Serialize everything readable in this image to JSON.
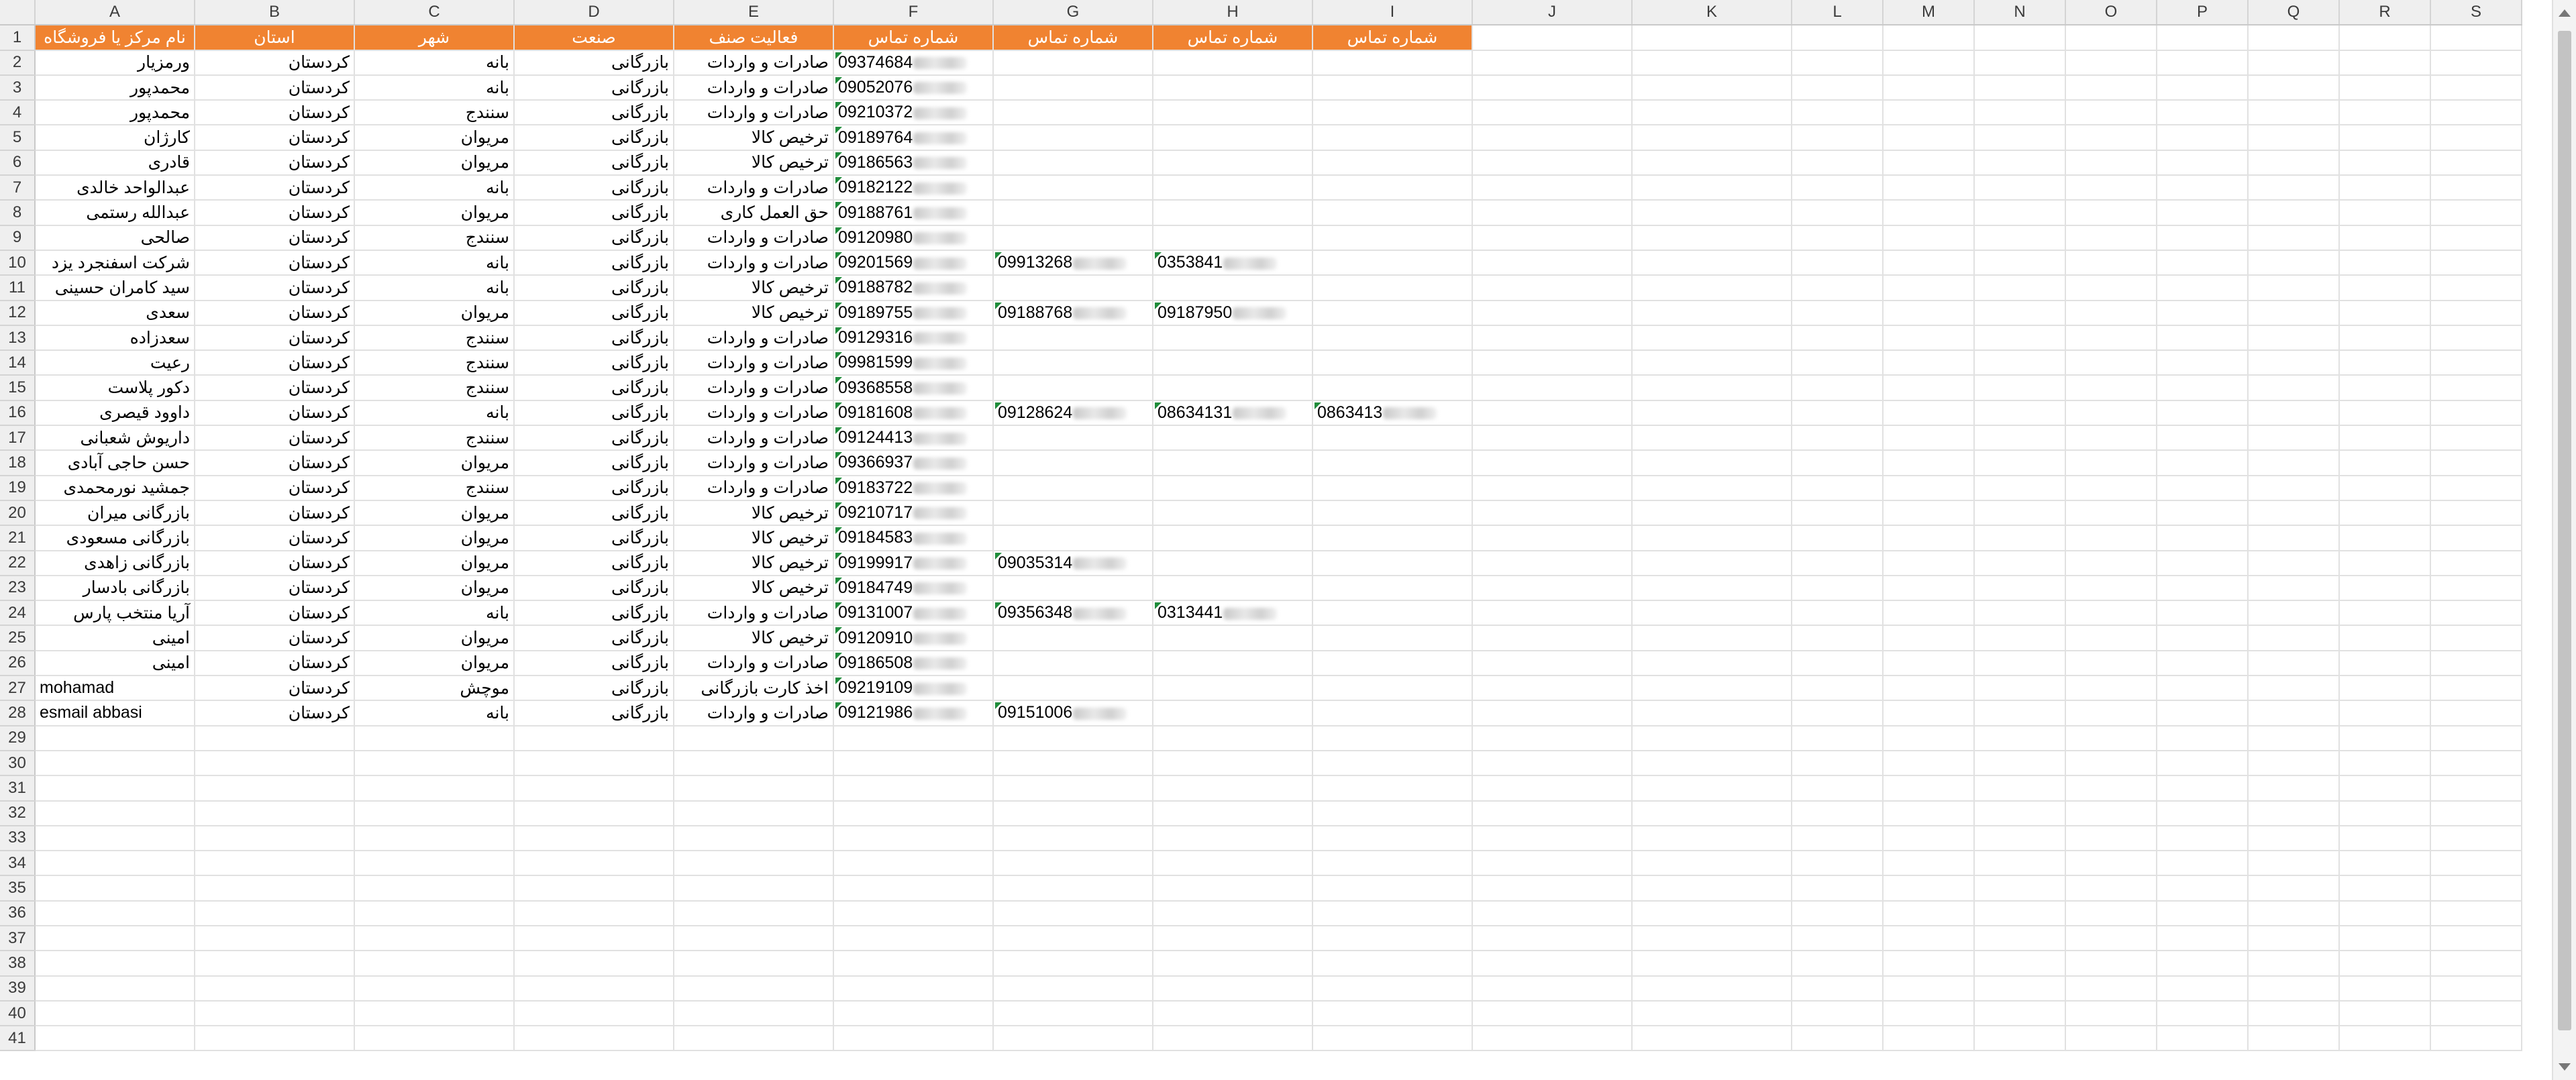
{
  "columns": [
    "A",
    "B",
    "C",
    "D",
    "E",
    "F",
    "G",
    "H",
    "I",
    "J",
    "K",
    "L",
    "M",
    "N",
    "O",
    "P",
    "Q",
    "R",
    "S"
  ],
  "header": [
    "نام مرکز یا فروشگاه",
    "استان",
    "شهر",
    "صنعت",
    "فعالیت صنف",
    "شماره تماس",
    "شماره تماس",
    "شماره تماس",
    "شماره تماس"
  ],
  "rows": [
    {
      "name": "ورمزیار",
      "province": "کردستان",
      "city": "بانه",
      "industry": "بازرگانی",
      "activity": "صادرات و واردات",
      "f": "09374684",
      "g": "",
      "h": "",
      "i": ""
    },
    {
      "name": "محمدپور",
      "province": "کردستان",
      "city": "بانه",
      "industry": "بازرگانی",
      "activity": "صادرات و واردات",
      "f": "09052076",
      "g": "",
      "h": "",
      "i": ""
    },
    {
      "name": "محمدپور",
      "province": "کردستان",
      "city": "سنندج",
      "industry": "بازرگانی",
      "activity": "صادرات و واردات",
      "f": "09210372",
      "g": "",
      "h": "",
      "i": ""
    },
    {
      "name": "کارژان",
      "province": "کردستان",
      "city": "مریوان",
      "industry": "بازرگانی",
      "activity": "ترخیص کالا",
      "f": "09189764",
      "g": "",
      "h": "",
      "i": ""
    },
    {
      "name": "قادری",
      "province": "کردستان",
      "city": "مریوان",
      "industry": "بازرگانی",
      "activity": "ترخیص کالا",
      "f": "09186563",
      "g": "",
      "h": "",
      "i": ""
    },
    {
      "name": "عبدالواحد خالدی",
      "province": "کردستان",
      "city": "بانه",
      "industry": "بازرگانی",
      "activity": "صادرات و واردات",
      "f": "09182122",
      "g": "",
      "h": "",
      "i": ""
    },
    {
      "name": "عبدالله رستمی",
      "province": "کردستان",
      "city": "مریوان",
      "industry": "بازرگانی",
      "activity": "حق العمل کاری",
      "f": "09188761",
      "g": "",
      "h": "",
      "i": ""
    },
    {
      "name": "صالحی",
      "province": "کردستان",
      "city": "سنندج",
      "industry": "بازرگانی",
      "activity": "صادرات و واردات",
      "f": "09120980",
      "g": "",
      "h": "",
      "i": ""
    },
    {
      "name": "شرکت اسفنجرد یزد",
      "province": "کردستان",
      "city": "بانه",
      "industry": "بازرگانی",
      "activity": "صادرات و واردات",
      "f": "09201569",
      "g": "09913268",
      "h": "0353841",
      "i": ""
    },
    {
      "name": "سید کامران حسینی",
      "province": "کردستان",
      "city": "بانه",
      "industry": "بازرگانی",
      "activity": "ترخیص کالا",
      "f": "09188782",
      "g": "",
      "h": "",
      "i": ""
    },
    {
      "name": "سعدی",
      "province": "کردستان",
      "city": "مریوان",
      "industry": "بازرگانی",
      "activity": "ترخیص کالا",
      "f": "09189755",
      "g": "09188768",
      "h": "09187950",
      "i": ""
    },
    {
      "name": "سعدزاده",
      "province": "کردستان",
      "city": "سنندج",
      "industry": "بازرگانی",
      "activity": "صادرات و واردات",
      "f": "09129316",
      "g": "",
      "h": "",
      "i": ""
    },
    {
      "name": "رعیت",
      "province": "کردستان",
      "city": "سنندج",
      "industry": "بازرگانی",
      "activity": "صادرات و واردات",
      "f": "09981599",
      "g": "",
      "h": "",
      "i": ""
    },
    {
      "name": "دکور پلاست",
      "province": "کردستان",
      "city": "سنندج",
      "industry": "بازرگانی",
      "activity": "صادرات و واردات",
      "f": "09368558",
      "g": "",
      "h": "",
      "i": ""
    },
    {
      "name": "داوود قیصری",
      "province": "کردستان",
      "city": "بانه",
      "industry": "بازرگانی",
      "activity": "صادرات و واردات",
      "f": "09181608",
      "g": "09128624",
      "h": "08634131",
      "i": "0863413"
    },
    {
      "name": "داریوش شعبانی",
      "province": "کردستان",
      "city": "سنندج",
      "industry": "بازرگانی",
      "activity": "صادرات و واردات",
      "f": "09124413",
      "g": "",
      "h": "",
      "i": ""
    },
    {
      "name": "حسن حاجی آبادی",
      "province": "کردستان",
      "city": "مریوان",
      "industry": "بازرگانی",
      "activity": "صادرات و واردات",
      "f": "09366937",
      "g": "",
      "h": "",
      "i": ""
    },
    {
      "name": "جمشید نورمحمدی",
      "province": "کردستان",
      "city": "سنندج",
      "industry": "بازرگانی",
      "activity": "صادرات و واردات",
      "f": "09183722",
      "g": "",
      "h": "",
      "i": ""
    },
    {
      "name": "بازرگانی میران",
      "province": "کردستان",
      "city": "مریوان",
      "industry": "بازرگانی",
      "activity": "ترخیص کالا",
      "f": "09210717",
      "g": "",
      "h": "",
      "i": ""
    },
    {
      "name": "بازرگانی مسعودی",
      "province": "کردستان",
      "city": "مریوان",
      "industry": "بازرگانی",
      "activity": "ترخیص کالا",
      "f": "09184583",
      "g": "",
      "h": "",
      "i": ""
    },
    {
      "name": "بازرگانی زاهدی",
      "province": "کردستان",
      "city": "مریوان",
      "industry": "بازرگانی",
      "activity": "ترخیص کالا",
      "f": "09199917",
      "g": "09035314",
      "h": "",
      "i": ""
    },
    {
      "name": "بازرگانی بادسار",
      "province": "کردستان",
      "city": "مریوان",
      "industry": "بازرگانی",
      "activity": "ترخیص کالا",
      "f": "09184749",
      "g": "",
      "h": "",
      "i": ""
    },
    {
      "name": "آریا منتخب پارس",
      "province": "کردستان",
      "city": "بانه",
      "industry": "بازرگانی",
      "activity": "صادرات و واردات",
      "f": "09131007",
      "g": "09356348",
      "h": "0313441",
      "i": ""
    },
    {
      "name": "امینی",
      "province": "کردستان",
      "city": "مریوان",
      "industry": "بازرگانی",
      "activity": "ترخیص کالا",
      "f": "09120910",
      "g": "",
      "h": "",
      "i": ""
    },
    {
      "name": "امینی",
      "province": "کردستان",
      "city": "مریوان",
      "industry": "بازرگانی",
      "activity": "صادرات و واردات",
      "f": "09186508",
      "g": "",
      "h": "",
      "i": ""
    },
    {
      "name": "mohamad",
      "province": "کردستان",
      "city": "موچش",
      "industry": "بازرگانی",
      "activity": "اخذ کارت بازرگانی",
      "f": "09219109",
      "g": "",
      "h": "",
      "i": ""
    },
    {
      "name": "esmail abbasi",
      "province": "کردستان",
      "city": "بانه",
      "industry": "بازرگانی",
      "activity": "صادرات و واردات",
      "f": "09121986",
      "g": "09151006",
      "h": "",
      "i": ""
    }
  ],
  "row_numbers": [
    "1",
    "2",
    "3",
    "4",
    "5",
    "6",
    "7",
    "8",
    "9",
    "10",
    "11",
    "12",
    "13",
    "14",
    "15",
    "16",
    "17",
    "18",
    "19",
    "20",
    "21",
    "22",
    "23",
    "24",
    "25",
    "26",
    "27",
    "28",
    "29",
    "30",
    "31",
    "32",
    "33",
    "34",
    "35",
    "36",
    "37",
    "38",
    "39",
    "40",
    "41"
  ]
}
